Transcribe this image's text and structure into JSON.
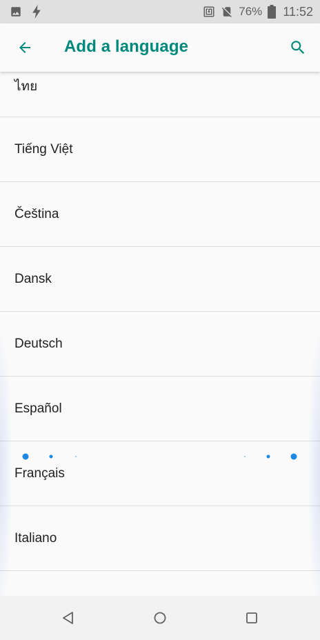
{
  "status_bar": {
    "battery_percent": "76%",
    "time": "11:52",
    "left_icons": [
      "image-icon",
      "flash-icon"
    ],
    "right_icons": [
      "nfc-icon",
      "no-sim-icon",
      "battery-icon"
    ]
  },
  "app_bar": {
    "title": "Add a language",
    "back_icon": "arrow-back-icon",
    "search_icon": "search-icon",
    "accent_color": "#00897b"
  },
  "languages": [
    "ไทย",
    "Tiếng Việt",
    "Čeština",
    "Dansk",
    "Deutsch",
    "Español",
    "Français",
    "Italiano"
  ],
  "loading_indicator": {
    "color": "#1e88e5"
  },
  "nav_bar": {
    "buttons": [
      "back-triangle-icon",
      "home-circle-icon",
      "recents-square-icon"
    ]
  }
}
